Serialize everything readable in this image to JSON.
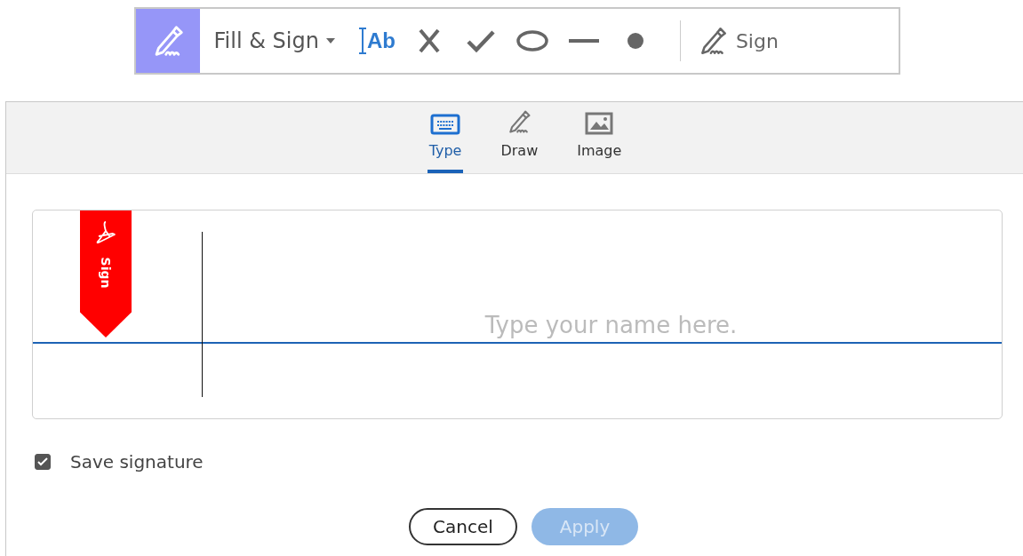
{
  "toolbar": {
    "mode_label": "Fill & Sign",
    "tools": [
      {
        "kind": "text",
        "label": "Ab",
        "selected": false
      },
      {
        "kind": "cross",
        "selected": false
      },
      {
        "kind": "check",
        "selected": false
      },
      {
        "kind": "ellipse",
        "selected": false
      },
      {
        "kind": "line",
        "selected": false
      },
      {
        "kind": "dot",
        "selected": false
      }
    ],
    "sign_label": "Sign"
  },
  "tabs": [
    {
      "kind": "keyboard",
      "label": "Type",
      "selected": true
    },
    {
      "kind": "pen",
      "label": "Draw",
      "selected": false
    },
    {
      "kind": "image",
      "label": "Image",
      "selected": false
    }
  ],
  "signature": {
    "flag_label": "Sign",
    "placeholder": "Type your name here."
  },
  "save_signature": {
    "label": "Save signature",
    "checked": true
  },
  "buttons": [
    {
      "label": "Cancel",
      "kind": "secondary",
      "disabled": false
    },
    {
      "label": "Apply",
      "kind": "primary",
      "disabled": true
    }
  ]
}
